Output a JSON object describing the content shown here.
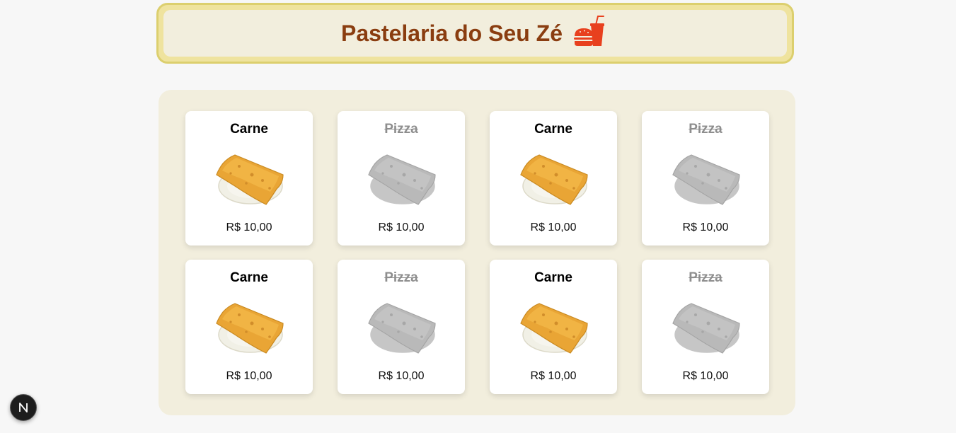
{
  "header": {
    "title": "Pastelaria do Seu Zé",
    "logo_icon": "fast-food-burger-drink-icon",
    "colors": {
      "title": "#8a3d10",
      "frame_border": "#dccf6e",
      "frame_fill": "#efe39e",
      "inner_fill": "#f2eedd",
      "icon": "#e8401e"
    }
  },
  "products": [
    {
      "name": "Carne",
      "price": "R$ 10,00",
      "available": true,
      "image": "pastel-image"
    },
    {
      "name": "Pizza",
      "price": "R$ 10,00",
      "available": false,
      "image": "pastel-image"
    },
    {
      "name": "Carne",
      "price": "R$ 10,00",
      "available": true,
      "image": "pastel-image"
    },
    {
      "name": "Pizza",
      "price": "R$ 10,00",
      "available": false,
      "image": "pastel-image"
    },
    {
      "name": "Carne",
      "price": "R$ 10,00",
      "available": true,
      "image": "pastel-image"
    },
    {
      "name": "Pizza",
      "price": "R$ 10,00",
      "available": false,
      "image": "pastel-image"
    },
    {
      "name": "Carne",
      "price": "R$ 10,00",
      "available": true,
      "image": "pastel-image"
    },
    {
      "name": "Pizza",
      "price": "R$ 10,00",
      "available": false,
      "image": "pastel-image"
    }
  ],
  "dev_badge": {
    "icon": "nextjs-logo-icon",
    "letter": "N"
  }
}
